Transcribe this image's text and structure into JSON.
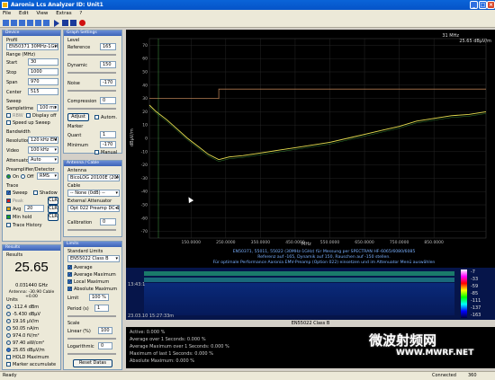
{
  "window": {
    "title": "Aaronia Lcs Analyzer    ID: Unit1"
  },
  "menu": [
    "File",
    "Edit",
    "View",
    "Extras",
    "?"
  ],
  "device": {
    "header": "Device",
    "profile_label": "Profil",
    "profile_value": "EN50371 30MHz-1GH",
    "range_label": "Range (MHz)",
    "start_label": "Start",
    "start_value": "30",
    "stop_label": "Stop",
    "stop_value": "1000",
    "span_label": "Span",
    "span_value": "970",
    "center_label": "Center",
    "center_value": "515",
    "sweep_label": "Sweep",
    "sampletime_label": "Sampletime",
    "sampletime_value": "100 ms",
    "rbw_label": "RBW",
    "display_off_label": "Display off",
    "speed_up_label": "Speed up Sweep",
    "bandwidth_label": "Bandwidth",
    "resolution_label": "Resolution",
    "resolution_value": "120 kHz EMI",
    "video_label": "Video",
    "video_value": "100 kHz",
    "attenuator_label": "Attenuator",
    "attenuator_value": "Auto",
    "preamp_label": "Preamplifier/Detector",
    "on_label": "On",
    "off_label": "Off",
    "detector_value": "RMS",
    "trace_label": "Trace",
    "sweep_trace_label": "Sweep",
    "shadow_label": "Shadow",
    "peak_label": "Peak",
    "avg_label": "Avg",
    "avg_value": "20",
    "peak_clr": "CLR",
    "avg_clr": "CLR",
    "minhold_label": "Min hold",
    "minhold_clr": "CLR",
    "history_label": "Trace History"
  },
  "results": {
    "header": "Results",
    "title": "Results",
    "big_value": "25.65",
    "freq": "0.031440 GHz",
    "antenna": "Antenna: -30.90 Cable +0.00",
    "units_label": "Units",
    "units": [
      "-112.4 dBm",
      "-5.430 dBµV",
      "19.16 µV/m",
      "50.05 nA/m",
      "974.0 fV/m²",
      "97.40 aW/cm²",
      "25.65 dBµV/m"
    ],
    "hold_label": "HOLD Maximum",
    "marker_acc_label": "Marker accumulate"
  },
  "graph": {
    "header": "Graph Settings",
    "level_label": "Level",
    "reference_label": "Reference",
    "reference_value": "165",
    "dynamic_label": "Dynamic",
    "dynamic_value": "150",
    "noise_label": "Noise",
    "noise_value": "-170",
    "compression_label": "Compression",
    "compression_value": "0",
    "adjust_label": "Adjust",
    "auto_label": "Autom.",
    "marker_label": "Marker",
    "quant_label": "Quant",
    "quant_value": "1",
    "minimum_label": "Minimum",
    "minimum_value": "-170",
    "manual_label": "Manual"
  },
  "antenna": {
    "header": "Antenna / Cable",
    "antenna_label": "Antenna",
    "antenna_value": "BicoLOG 20100E (20M",
    "cable_label": "Cable",
    "cable_value": "-- None (0dB) --",
    "ext_att_label": "External Attenuator",
    "ext_att_value": "Opt 022 Preamp DC-1G",
    "calibration_label": "Calibration",
    "calibration_value": "0"
  },
  "limits": {
    "header": "Limits",
    "standard_label": "Standard Limits",
    "standard_value": "EN55022 Class B",
    "average_label": "Average",
    "average_max_label": "Average Maximum",
    "local_max_label": "Local Maximum",
    "absolute_max_label": "Absolute Maximum",
    "limit_label": "Limit",
    "limit_value": "100 %",
    "period_label": "Period (s)",
    "period_value": "1",
    "scale_label": "Scale",
    "linear_label": "Linear (%)",
    "linear_value": "100",
    "log_label": "Logarithmic",
    "log_value": "0",
    "reset_label": "Reset Datas"
  },
  "plot": {
    "top_freq": "31 MHz",
    "top_level": "25.65 dBµV/m",
    "ylabel": "dBµV/m",
    "xlabel": "MHz",
    "info_lines": [
      "EN50371, 55011, 55022 (30MHz-1GHz) für Messung per SPECTRAN HF-6065/6080/6085",
      "Referenz auf -165, Dynamik auf 150, Rauschen auf -150 stellen.",
      "Für optimale Performance Aaronia EMV-Preamp (Option 022) einsetzen und im Attenuator Menü auswählen"
    ]
  },
  "chart_data": {
    "type": "line",
    "xlabel": "MHz",
    "ylabel": "dBµV/m",
    "x_ticks": [
      "150.0000",
      "250.0000",
      "350.0000",
      "450.0000",
      "550.0000",
      "650.0000",
      "750.0000",
      "850.0000"
    ],
    "y_ticks": [
      "70",
      "60",
      "50",
      "40",
      "30",
      "20",
      "10",
      "0",
      "-10",
      "-20",
      "-30",
      "-40",
      "-50",
      "-60",
      "-70"
    ],
    "xlim": [
      30,
      1000
    ],
    "ylim": [
      -75,
      75
    ],
    "series": [
      {
        "x": [
          30,
          50,
          80,
          110,
          140,
          170,
          200,
          230,
          260,
          300,
          350,
          400,
          450,
          500,
          550,
          600,
          650,
          700,
          750,
          800,
          850,
          900,
          950,
          1000
        ],
        "y": [
          25,
          20,
          14,
          7,
          0,
          -6,
          -12,
          -16,
          -14,
          -13,
          -11,
          -9,
          -7,
          -5,
          -3,
          0,
          3,
          6,
          9,
          13,
          15,
          17,
          18,
          20
        ]
      }
    ],
    "limit_line": {
      "x": [
        30,
        230,
        230,
        1000
      ],
      "y": [
        30,
        30,
        37,
        37
      ]
    }
  },
  "waterfall": {
    "timestamp_top": "13:43:1",
    "timestamp_bottom": "23.03.10 15:27:33m",
    "scale": [
      "-7",
      "-33",
      "-59",
      "-85",
      "-111",
      "-137",
      "-163"
    ],
    "title": "EN55022 Class B"
  },
  "status": {
    "lines": [
      "Active: 0.000 %",
      "Average over 1 Seconds: 0.000 %",
      "Average Maximum over 1 Seconds: 0.000 %",
      "Maximum of last 1 Seconds: 0.000 %",
      "Absolute Maximum: 0.000 %"
    ]
  },
  "statusbar": {
    "left": "Ready",
    "connected": "Connected",
    "count": "360"
  },
  "watermark": {
    "text": "微波射频网",
    "url": "WWW.MWRF.NET"
  }
}
